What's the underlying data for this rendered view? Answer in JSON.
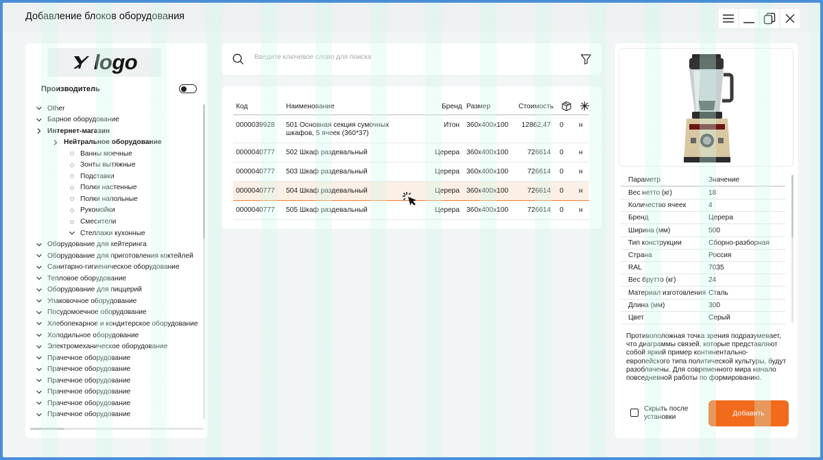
{
  "window": {
    "title": "Добавление блоков оборудования"
  },
  "logo": {
    "text": "logo"
  },
  "sidebar": {
    "maker_label": "Производитель",
    "tree": [
      {
        "label": "Other",
        "icon": "chevron-down",
        "level": 0,
        "bold": false
      },
      {
        "label": "Барное оборудование",
        "icon": "chevron-down",
        "level": 0,
        "bold": false
      },
      {
        "label": "Интернет-магазин",
        "icon": "chevron-right",
        "level": 0,
        "bold": true
      },
      {
        "label": "Нейтральное оборудование",
        "icon": "chevron-right",
        "level": 1,
        "bold": true
      },
      {
        "label": "Ванны моечные",
        "icon": "dot",
        "level": 2,
        "bold": false
      },
      {
        "label": "Зонты вытяжные",
        "icon": "dot",
        "level": 2,
        "bold": false
      },
      {
        "label": "Подставки",
        "icon": "dot",
        "level": 2,
        "bold": false
      },
      {
        "label": "Полки настенные",
        "icon": "dot",
        "level": 2,
        "bold": false
      },
      {
        "label": "Полки напольные",
        "icon": "dot",
        "level": 2,
        "bold": false
      },
      {
        "label": "Рукомойки",
        "icon": "dot",
        "level": 2,
        "bold": false
      },
      {
        "label": "Смесители",
        "icon": "dot",
        "level": 2,
        "bold": false
      },
      {
        "label": "Стеллажи кухонные",
        "icon": "chevron-down",
        "level": 2,
        "bold": false
      },
      {
        "label": "Оборудование для кейтеринга",
        "icon": "chevron-down",
        "level": 0,
        "bold": false
      },
      {
        "label": "Оборудование для приготовления коктейлей",
        "icon": "chevron-down",
        "level": 0,
        "bold": false
      },
      {
        "label": "Санитарно-гигиеническое оборудование",
        "icon": "chevron-down",
        "level": 0,
        "bold": false
      },
      {
        "label": "Тепловое оборудование",
        "icon": "chevron-down",
        "level": 0,
        "bold": false
      },
      {
        "label": "Оборудование для пиццерий",
        "icon": "chevron-down",
        "level": 0,
        "bold": false
      },
      {
        "label": "Упаковочное оборудование",
        "icon": "chevron-down",
        "level": 0,
        "bold": false
      },
      {
        "label": "Посудомоечное оборудование",
        "icon": "chevron-down",
        "level": 0,
        "bold": false
      },
      {
        "label": "Хлебопекарное и кондитерское оборудование",
        "icon": "chevron-down",
        "level": 0,
        "bold": false
      },
      {
        "label": "Холодильное оборудование",
        "icon": "chevron-down",
        "level": 0,
        "bold": false
      },
      {
        "label": "Электромеханическое оборудование",
        "icon": "chevron-down",
        "level": 0,
        "bold": false
      },
      {
        "label": "Прачечное оборудование",
        "icon": "chevron-down",
        "level": 0,
        "bold": false
      },
      {
        "label": "Прачечное оборудование",
        "icon": "chevron-down",
        "level": 0,
        "bold": false
      },
      {
        "label": "Прачечное оборудование",
        "icon": "chevron-down",
        "level": 0,
        "bold": false
      },
      {
        "label": "Прачечное оборудование",
        "icon": "chevron-down",
        "level": 0,
        "bold": false
      },
      {
        "label": "Прачечное оборудование",
        "icon": "chevron-down",
        "level": 0,
        "bold": false
      },
      {
        "label": "Прачечное оборудование",
        "icon": "chevron-down",
        "level": 0,
        "bold": false
      }
    ]
  },
  "search": {
    "value": "",
    "placeholder": "Введите ключевое слово для поиска"
  },
  "table": {
    "columns": [
      "Код",
      "Наименование",
      "Бренд",
      "Размер",
      "Стоимость"
    ],
    "rows": [
      {
        "code": "0000039928",
        "name": "501 Основная секция сумочных шкафов, 5 ячеек (360*37)",
        "brand": "Итон",
        "size": "360x400x100",
        "price": "12862,47",
        "stock": "0",
        "flag": "н",
        "selected": false
      },
      {
        "code": "0000040777",
        "name": "502 Шкаф раздевальный",
        "brand": "Церера",
        "size": "360x400x100",
        "price": "726614",
        "stock": "0",
        "flag": "н",
        "selected": false
      },
      {
        "code": "0000040777",
        "name": "503 Шкаф раздевальный",
        "brand": "Церера",
        "size": "360x400x100",
        "price": "726614",
        "stock": "0",
        "flag": "н",
        "selected": false
      },
      {
        "code": "0000040777",
        "name": "504 Шкаф раздевальный",
        "brand": "Церера",
        "size": "360x400x100",
        "price": "726614",
        "stock": "0",
        "flag": "н",
        "selected": true
      },
      {
        "code": "0000040777",
        "name": "505 Шкаф раздевальный",
        "brand": "Церера",
        "size": "360x400x100",
        "price": "726614",
        "stock": "0",
        "flag": "н",
        "selected": false
      }
    ]
  },
  "details": {
    "header": {
      "k": "Параметр",
      "v": "Значение"
    },
    "params": [
      {
        "k": "Вес нетто (кг)",
        "v": "18"
      },
      {
        "k": "Количество ячеек",
        "v": "4"
      },
      {
        "k": "Бренд",
        "v": "Церера"
      },
      {
        "k": "Ширина (мм)",
        "v": "500"
      },
      {
        "k": "Тип конструкции",
        "v": "Сборно-разборная"
      },
      {
        "k": "Страна",
        "v": "Россия"
      },
      {
        "k": "RAL",
        "v": "7035"
      },
      {
        "k": "Вес брутто (кг)",
        "v": "24"
      },
      {
        "k": "Материал изготовления",
        "v": "Сталь"
      },
      {
        "k": "Длина (мм)",
        "v": "300"
      },
      {
        "k": "Цвет",
        "v": "Серый"
      }
    ],
    "description": "Противоположная точка зрения подразумевает, что диаграммы связей, которые представляют собой яркий пример континентально-европейского типа политической культуры, будут разоблачены. Для современного мира начало повседневной работы по формированию.",
    "hide_after_install_label": "Скрыть после установки",
    "add_label": "Добавить"
  },
  "colors": {
    "accent": "#f26a1b",
    "selected_row": "#fcefe5",
    "frame": "#4a8fd6",
    "background": "#f2f5f5"
  }
}
